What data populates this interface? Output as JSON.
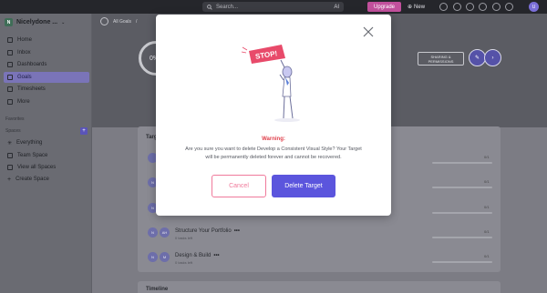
{
  "topbar": {
    "search_placeholder": "Search...",
    "ai_label": "AI",
    "upgrade_label": "Upgrade",
    "new_label": "New",
    "avatar_initials": "U"
  },
  "sidebar": {
    "workspace_logo": "N",
    "workspace_name": "Nicelydone ...",
    "items": [
      {
        "label": "Home",
        "icon": "home-icon"
      },
      {
        "label": "Inbox",
        "icon": "inbox-icon"
      },
      {
        "label": "Dashboards",
        "icon": "dashboard-icon"
      },
      {
        "label": "Goals",
        "icon": "goals-icon",
        "active": true
      },
      {
        "label": "Timesheets",
        "icon": "timesheet-icon"
      },
      {
        "label": "More",
        "icon": "more-icon"
      }
    ],
    "favorites_label": "Favorites",
    "spaces_label": "Spaces",
    "spaces_plus": "+",
    "space_items": [
      {
        "label": "Everything",
        "icon": "everything-icon"
      },
      {
        "label": "Team Space",
        "icon": "team-space-icon"
      },
      {
        "label": "View all Spaces",
        "icon": "view-spaces-icon"
      },
      {
        "label": "Create Space",
        "icon": "plus-icon"
      }
    ]
  },
  "header": {
    "breadcrumb": "All Goals",
    "breadcrumb_sep": "/",
    "progress_text": "0%",
    "share_line1": "SHARING &",
    "share_line2": "PERMISSIONS"
  },
  "targets": {
    "title": "Target",
    "rows": [
      {
        "name": "",
        "sub": "",
        "frac": "0/1",
        "avatars": [
          ""
        ]
      },
      {
        "name": "",
        "sub": "",
        "frac": "0/1",
        "avatars": [
          "N"
        ]
      },
      {
        "name": "",
        "sub": "",
        "frac": "0/1",
        "avatars": [
          "N"
        ]
      },
      {
        "name": "Structure Your Portfolio",
        "dots": "•••",
        "sub": "0 tasks left",
        "frac": "0/1",
        "avatars": [
          "N",
          "AH"
        ]
      },
      {
        "name": "Design & Build",
        "dots": "•••",
        "sub": "0 tasks left",
        "frac": "0/1",
        "avatars": [
          "N",
          "M"
        ]
      }
    ]
  },
  "timeline": {
    "title": "Timeline"
  },
  "modal": {
    "stop_sign": "STOP!",
    "warning_title": "Warning:",
    "warning_text": "Are you sure you want to delete Develop a Consistent Visual Style? Your Target will be permanently deleted forever and cannot be recovered.",
    "cancel_label": "Cancel",
    "delete_label": "Delete Target"
  },
  "colors": {
    "accent": "#5b55dd",
    "danger": "#e0424d",
    "cancel_border": "#f07a9b",
    "upgrade": "#c2509c"
  }
}
